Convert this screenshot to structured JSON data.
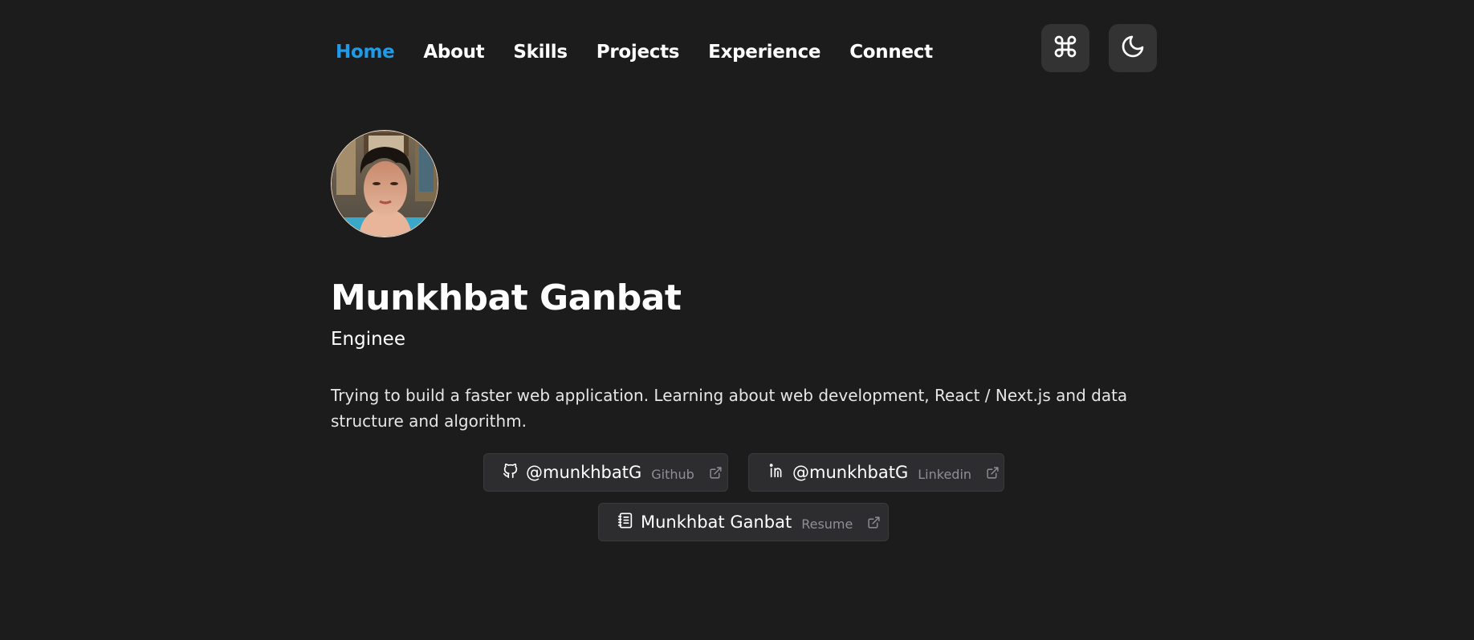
{
  "nav": {
    "items": [
      {
        "label": "Home",
        "active": true
      },
      {
        "label": "About",
        "active": false
      },
      {
        "label": "Skills",
        "active": false
      },
      {
        "label": "Projects",
        "active": false
      },
      {
        "label": "Experience",
        "active": false
      },
      {
        "label": "Connect",
        "active": false
      }
    ],
    "command_icon": "command-icon",
    "theme_icon": "moon-icon"
  },
  "profile": {
    "name": "Munkhbat Ganbat",
    "role": "Enginee",
    "bio": "Trying to build a faster web application. Learning about web development, React / Next.js and data structure and algorithm."
  },
  "links": [
    {
      "handle": "@munkhbatG",
      "kind": "Github",
      "icon": "github-icon"
    },
    {
      "handle": "@munkhbatG",
      "kind": "Linkedin",
      "icon": "linkedin-icon"
    },
    {
      "handle": "Munkhbat Ganbat",
      "kind": "Resume",
      "icon": "notebook-icon"
    }
  ],
  "colors": {
    "background": "#1c1c1c",
    "accent": "#1e9ce8",
    "card": "#2d2d30",
    "button": "#333333"
  }
}
